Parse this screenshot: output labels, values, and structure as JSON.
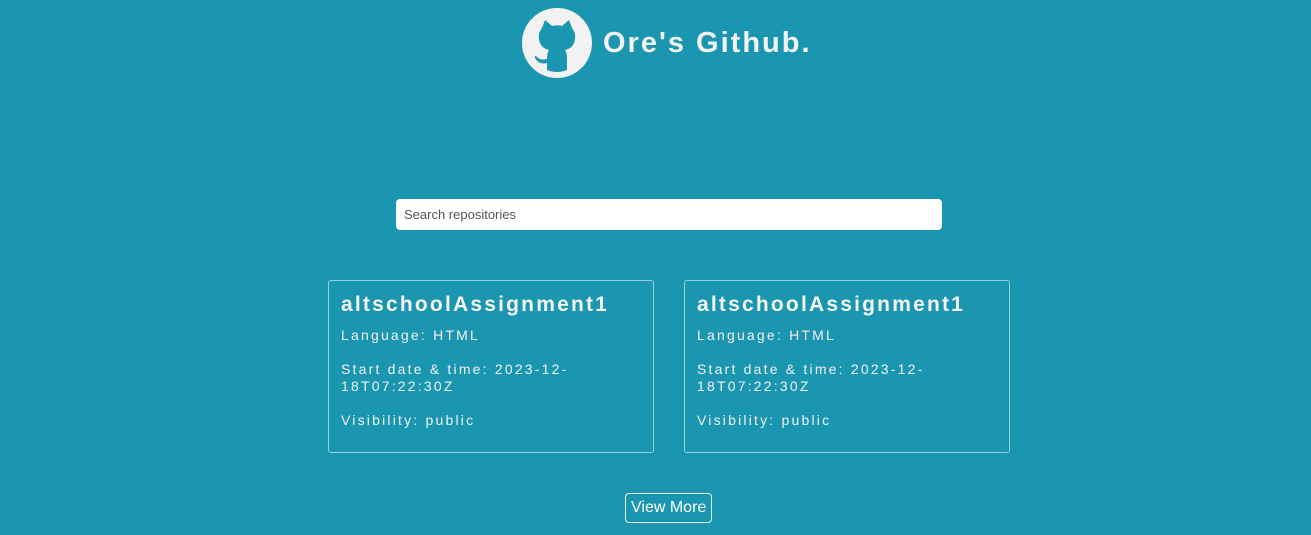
{
  "header": {
    "title": "Ore's Github.",
    "logo_icon": "github-octocat-icon"
  },
  "search": {
    "placeholder": "Search repositories",
    "value": ""
  },
  "repos": [
    {
      "name": "altschoolAssignment1",
      "language": "Language: HTML",
      "start": "Start date & time: 2023-12-18T07:22:30Z",
      "visibility": "Visibility: public"
    },
    {
      "name": "altschoolAssignment1",
      "language": "Language: HTML",
      "start": "Start date & time: 2023-12-18T07:22:30Z",
      "visibility": "Visibility: public"
    }
  ],
  "actions": {
    "view_more_label": "View More"
  },
  "colors": {
    "background": "#1a96b0",
    "logo_bg": "#f2f2f2",
    "text": "#f3f3f3"
  }
}
